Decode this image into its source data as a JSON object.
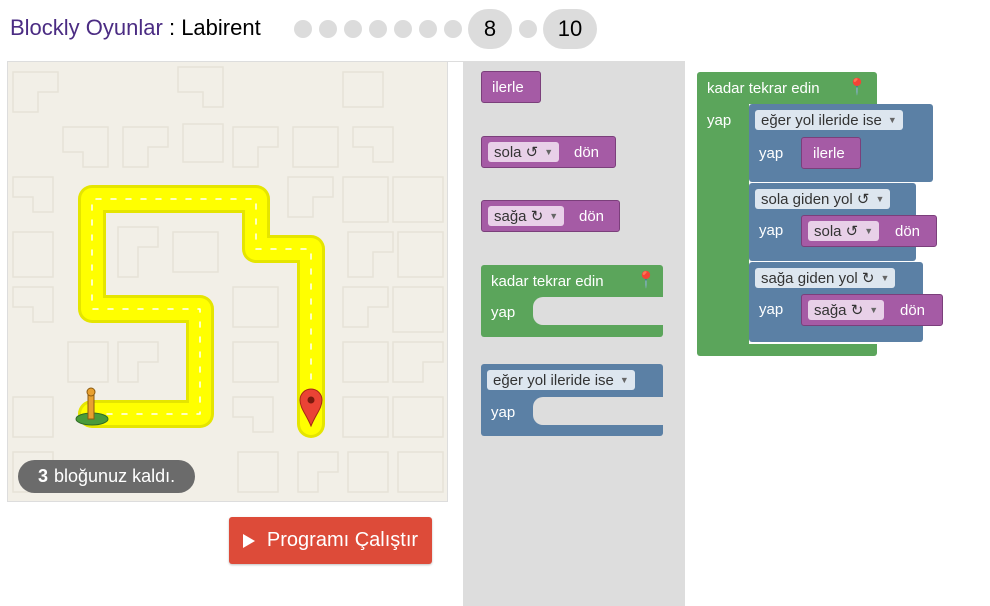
{
  "header": {
    "app_link": "Blockly Oyunlar",
    "separator": " : ",
    "game_title": "Labirent",
    "levels": [
      "1",
      "2",
      "3",
      "4",
      "5",
      "6",
      "7",
      "8",
      "9",
      "10"
    ],
    "current_level": "8",
    "last_level": "10"
  },
  "maze": {
    "remaining_count": "3",
    "remaining_text": "bloğunuz kaldı."
  },
  "run_button_label": "Programı Çalıştır",
  "toolbox": {
    "forward": "ilerle",
    "turn_left_option": "sola ↺",
    "turn_right_option": "sağa ↻",
    "turn_word": "dön",
    "repeat_until": "kadar tekrar edin",
    "do": "yap",
    "if_path": "eğer yol ileride ise"
  },
  "workspace": {
    "repeat_until": "kadar tekrar edin",
    "do": "yap",
    "if_ahead": "eğer yol ileride ise",
    "forward": "ilerle",
    "if_left": "sola giden yol ↺",
    "turn_left_option": "sola ↺",
    "if_right": "sağa giden yol ↻",
    "turn_right_option": "sağa ↻",
    "turn_word": "dön"
  },
  "colors": {
    "movement_block": "#a55ba5",
    "loop_block": "#5ba55b",
    "logic_block": "#5b80a5",
    "run_button": "#dd4b39",
    "path": "#ffff00",
    "link": "#4b2c83"
  }
}
